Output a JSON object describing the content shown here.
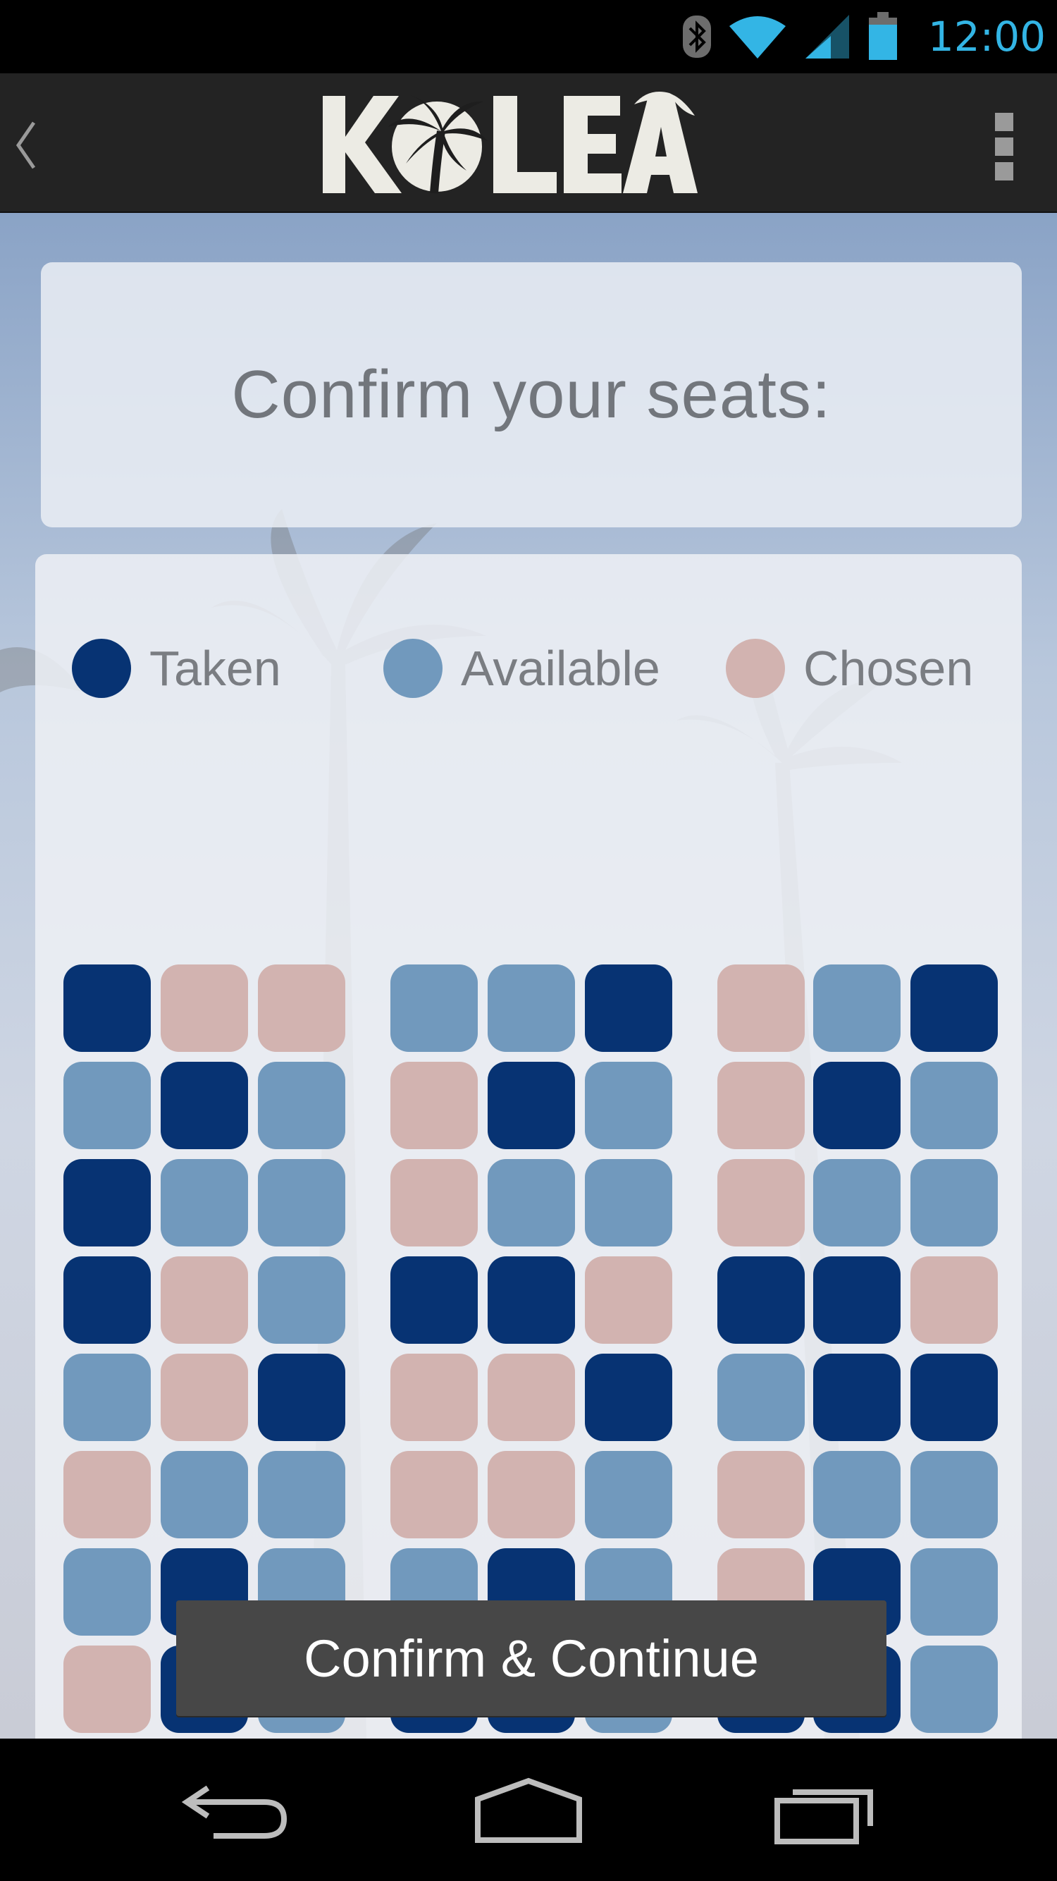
{
  "status_bar": {
    "time": "12:00",
    "icons": [
      "bluetooth-icon",
      "wifi-icon",
      "signal-icon",
      "battery-icon"
    ],
    "accent_color": "#33b5e5"
  },
  "action_bar": {
    "logo_text": "KOLEA",
    "back_icon": "chevron-left-icon",
    "menu_icon": "overflow-menu-icon"
  },
  "page": {
    "title": "Confirm your seats:"
  },
  "legend": [
    {
      "key": "taken",
      "label": "Taken",
      "color": "#073373"
    },
    {
      "key": "available",
      "label": "Available",
      "color": "#7199bd"
    },
    {
      "key": "chosen",
      "label": "Chosen",
      "color": "#d2b3b0"
    }
  ],
  "seat_map": {
    "sections": 3,
    "columns_per_section": 3,
    "rows": [
      [
        [
          "taken",
          "chosen",
          "chosen"
        ],
        [
          "available",
          "available",
          "taken"
        ],
        [
          "chosen",
          "available",
          "taken"
        ]
      ],
      [
        [
          "available",
          "taken",
          "available"
        ],
        [
          "chosen",
          "taken",
          "available"
        ],
        [
          "chosen",
          "taken",
          "available"
        ]
      ],
      [
        [
          "taken",
          "available",
          "available"
        ],
        [
          "chosen",
          "available",
          "available"
        ],
        [
          "chosen",
          "available",
          "available"
        ]
      ],
      [
        [
          "taken",
          "chosen",
          "available"
        ],
        [
          "taken",
          "taken",
          "chosen"
        ],
        [
          "taken",
          "taken",
          "chosen"
        ]
      ],
      [
        [
          "available",
          "chosen",
          "taken"
        ],
        [
          "chosen",
          "chosen",
          "taken"
        ],
        [
          "available",
          "taken",
          "taken"
        ]
      ],
      [
        [
          "chosen",
          "available",
          "available"
        ],
        [
          "chosen",
          "chosen",
          "available"
        ],
        [
          "chosen",
          "available",
          "available"
        ]
      ],
      [
        [
          "available",
          "taken",
          "available"
        ],
        [
          "available",
          "taken",
          "available"
        ],
        [
          "chosen",
          "taken",
          "available"
        ]
      ],
      [
        [
          "chosen",
          "taken",
          "available"
        ],
        [
          "taken",
          "taken",
          "available"
        ],
        [
          "taken",
          "taken",
          "available"
        ]
      ]
    ]
  },
  "cta": {
    "label": "Confirm & Continue"
  },
  "nav_bar": {
    "buttons": [
      "back-icon",
      "home-icon",
      "recent-apps-icon"
    ]
  }
}
